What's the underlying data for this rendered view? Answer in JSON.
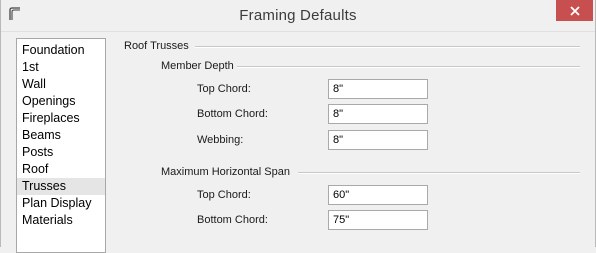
{
  "window": {
    "title": "Framing Defaults"
  },
  "sidebar": {
    "items": [
      {
        "label": "Foundation"
      },
      {
        "label": "1st"
      },
      {
        "label": "Wall"
      },
      {
        "label": "Openings"
      },
      {
        "label": "Fireplaces"
      },
      {
        "label": "Beams"
      },
      {
        "label": "Posts"
      },
      {
        "label": "Roof"
      },
      {
        "label": "Trusses",
        "selected": true
      },
      {
        "label": "Plan Display"
      },
      {
        "label": "Materials"
      }
    ]
  },
  "panel": {
    "section_title": "Roof Trusses",
    "member_depth": {
      "title": "Member Depth",
      "top_chord": {
        "label": "Top Chord:",
        "value": "8\""
      },
      "bottom_chord": {
        "label": "Bottom Chord:",
        "value": "8\""
      },
      "webbing": {
        "label": "Webbing:",
        "value": "8\""
      }
    },
    "max_span": {
      "title": "Maximum Horizontal Span",
      "top_chord": {
        "label": "Top Chord:",
        "value": "60\""
      },
      "bottom_chord": {
        "label": "Bottom Chord:",
        "value": "75\""
      }
    }
  },
  "colors": {
    "close_button": "#c74f4f",
    "selected_item": "#e5e5e5"
  },
  "icons": {
    "app": "roof-outline-icon",
    "close": "close-icon"
  }
}
